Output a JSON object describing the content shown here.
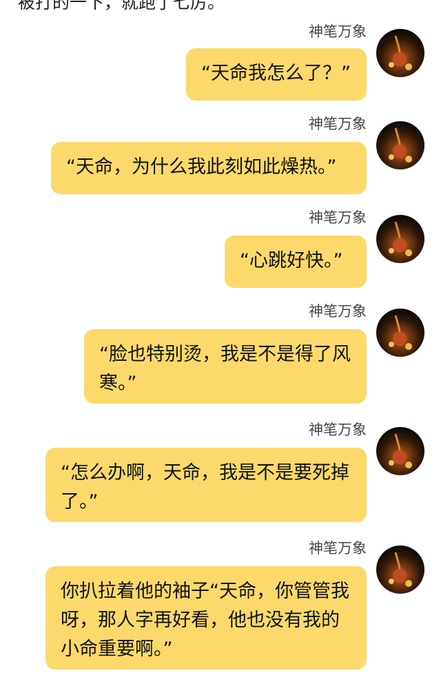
{
  "top_fragment": "被打的一下，就跑了七厉。",
  "messages": [
    {
      "sender": "神笔万象",
      "text": "“天命我怎么了？”"
    },
    {
      "sender": "神笔万象",
      "text": "“天命，为什么我此刻如此燥热。”"
    },
    {
      "sender": "神笔万象",
      "text": "“心跳好快。”"
    },
    {
      "sender": "神笔万象",
      "text": "“脸也特别烫，我是不是得了风寒。”"
    },
    {
      "sender": "神笔万象",
      "text": "“怎么办啊，天命，我是不是要死掉了。”"
    },
    {
      "sender": "神笔万象",
      "text": "你扒拉着他的袖子“天命，你管管我呀，那人字再好看，他也没有我的小命重要啊。”"
    }
  ],
  "icons": {
    "avatar": "avatar-icon"
  },
  "colors": {
    "bubble": "#fcd96a",
    "background": "#ffffff"
  }
}
